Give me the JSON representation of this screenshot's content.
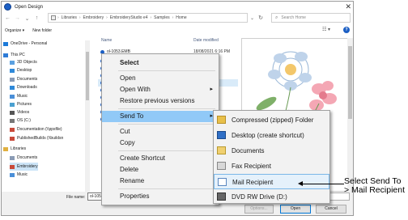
{
  "window": {
    "title": "Open Design",
    "close_glyph": "✕"
  },
  "address": {
    "breadcrumbs": [
      "Libraries",
      "Embroidery",
      "EmbroideryStudio e4",
      "Samples",
      "Home"
    ],
    "separator": "›"
  },
  "search": {
    "placeholder": "Search Home"
  },
  "toolbar": {
    "organize": "Organize ▾",
    "new_folder": "New folder",
    "view_glyph": "☷ ▾",
    "help_glyph": "?"
  },
  "navigation": {
    "items": [
      {
        "label": "OneDrive - Personal",
        "icon": "onedrive-icon"
      },
      {
        "label": "This PC",
        "icon": "computer-icon"
      },
      {
        "label": "3D Objects",
        "icon": "cube-icon"
      },
      {
        "label": "Desktop",
        "icon": "desktop-icon"
      },
      {
        "label": "Documents",
        "icon": "document-icon"
      },
      {
        "label": "Downloads",
        "icon": "download-icon"
      },
      {
        "label": "Music",
        "icon": "music-icon"
      },
      {
        "label": "Pictures",
        "icon": "pictures-icon"
      },
      {
        "label": "Videos",
        "icon": "video-icon"
      },
      {
        "label": "OS (C:)",
        "icon": "drive-icon"
      },
      {
        "label": "Documentation (\\\\ppsfile)",
        "icon": "network-drive-icon"
      },
      {
        "label": "PublishedBuilds (\\\\buildsn",
        "icon": "network-drive-icon"
      },
      {
        "label": "Libraries",
        "icon": "libraries-icon"
      },
      {
        "label": "Documents",
        "icon": "document-icon"
      },
      {
        "label": "Embroidery",
        "icon": "embroidery-icon"
      },
      {
        "label": "Music",
        "icon": "music-icon"
      }
    ]
  },
  "files": {
    "columns": {
      "name": "Name",
      "date": "Date modified"
    },
    "rows": [
      {
        "name": "ol-1053.EMB",
        "date": "18/08/2021 6:16 PM"
      },
      {
        "name": "",
        "date": "PM"
      },
      {
        "name": "",
        "date": "PM"
      },
      {
        "name": "",
        "date": "PM"
      },
      {
        "name": "",
        "date": "PM"
      },
      {
        "name": "",
        "date": "PM"
      },
      {
        "name": "",
        "date": "PM"
      },
      {
        "name": "",
        "date": "PM"
      },
      {
        "name": "",
        "date": "PM"
      },
      {
        "name": "",
        "date": "PM"
      }
    ]
  },
  "context_menu": {
    "items": [
      {
        "label": "Select",
        "bold": true
      },
      {
        "label": "Open"
      },
      {
        "label": "Open With",
        "submenu": true
      },
      {
        "label": "Restore previous versions"
      },
      {
        "label": "Send To",
        "submenu": true,
        "active": true
      },
      {
        "label": "Cut"
      },
      {
        "label": "Copy"
      },
      {
        "label": "Create Shortcut"
      },
      {
        "label": "Delete"
      },
      {
        "label": "Rename"
      },
      {
        "label": "Properties"
      }
    ],
    "arrow": "▸"
  },
  "send_to_menu": {
    "items": [
      {
        "label": "Compressed (zipped) Folder",
        "icon": "zip-folder-icon"
      },
      {
        "label": "Desktop (create shortcut)",
        "icon": "desktop-icon"
      },
      {
        "label": "Documents",
        "icon": "document-icon"
      },
      {
        "label": "Fax Recipient",
        "icon": "fax-icon"
      },
      {
        "label": "Mail Recipient",
        "icon": "mail-icon",
        "active": true
      },
      {
        "label": "DVD RW Drive (D:)",
        "icon": "dvd-drive-icon"
      }
    ]
  },
  "bottom": {
    "file_name_label": "File name:",
    "file_name_value": "ol-1053.E",
    "file_type": "Wilcom All-in-One Designs (*.E",
    "options": "Options...",
    "open": "Open",
    "cancel": "Cancel"
  },
  "callout": {
    "text": "Select Send To > Mail Recipient"
  }
}
